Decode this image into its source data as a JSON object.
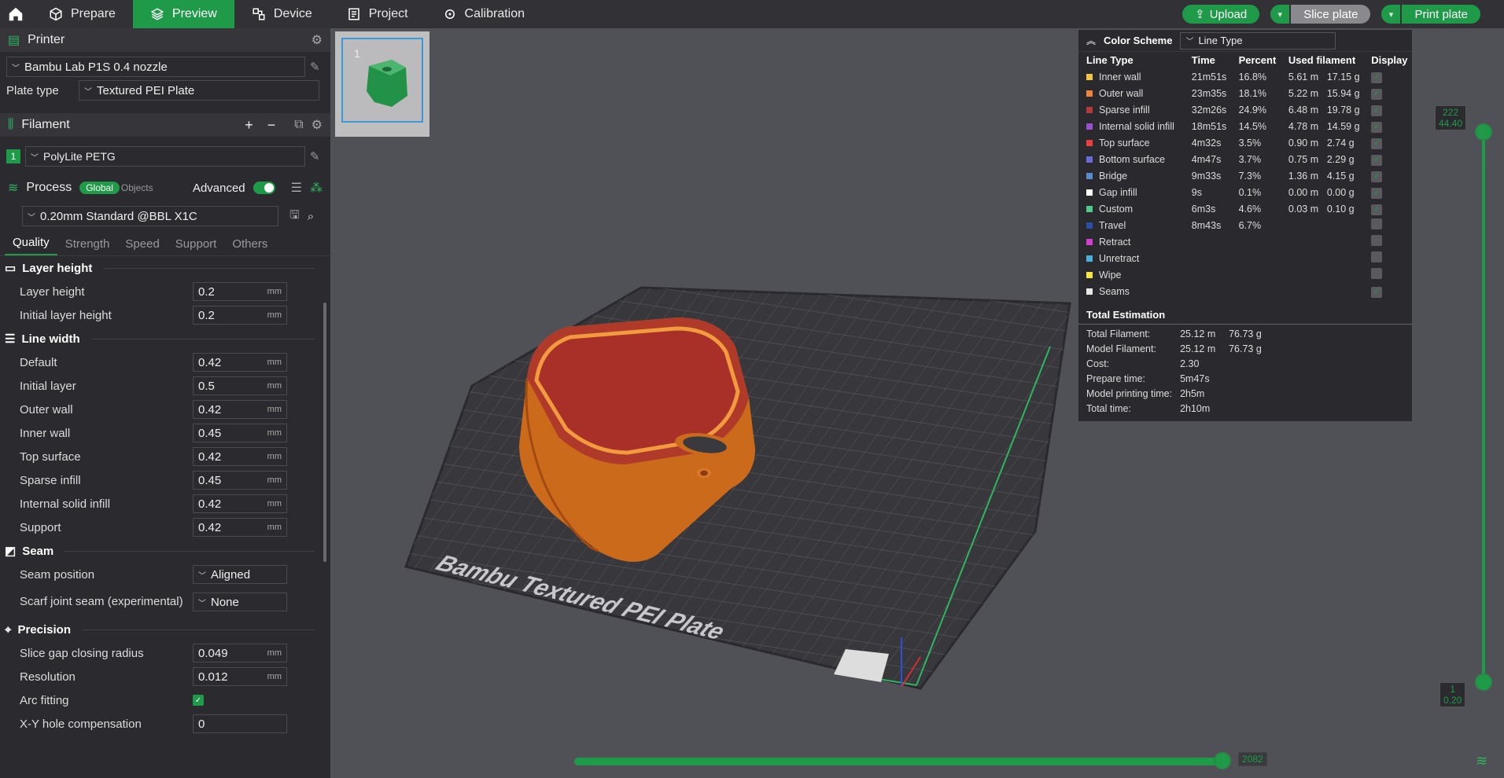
{
  "topbar": {
    "tabs": [
      {
        "label": "Prepare"
      },
      {
        "label": "Preview"
      },
      {
        "label": "Device"
      },
      {
        "label": "Project"
      },
      {
        "label": "Calibration"
      }
    ],
    "upload_label": "Upload",
    "slice_label": "Slice plate",
    "print_label": "Print plate"
  },
  "printer": {
    "section_title": "Printer",
    "selected": "Bambu Lab P1S 0.4 nozzle",
    "plate_type_label": "Plate type",
    "plate_type": "Textured PEI Plate"
  },
  "filament": {
    "section_title": "Filament",
    "slot": "1",
    "name": "PolyLite PETG"
  },
  "process": {
    "section_title": "Process",
    "global_label": "Global",
    "objects_label": "Objects",
    "advanced_label": "Advanced",
    "profile": "0.20mm Standard @BBL X1C",
    "tabs": [
      "Quality",
      "Strength",
      "Speed",
      "Support",
      "Others"
    ],
    "groups": {
      "layer_height": "Layer height",
      "line_width": "Line width",
      "seam": "Seam",
      "precision": "Precision"
    },
    "params": {
      "layer_height": {
        "label": "Layer height",
        "value": "0.2",
        "unit": "mm"
      },
      "initial_layer_height": {
        "label": "Initial layer height",
        "value": "0.2",
        "unit": "mm"
      },
      "lw_default": {
        "label": "Default",
        "value": "0.42",
        "unit": "mm"
      },
      "lw_initial": {
        "label": "Initial layer",
        "value": "0.5",
        "unit": "mm"
      },
      "lw_outer": {
        "label": "Outer wall",
        "value": "0.42",
        "unit": "mm"
      },
      "lw_inner": {
        "label": "Inner wall",
        "value": "0.45",
        "unit": "mm"
      },
      "lw_top": {
        "label": "Top surface",
        "value": "0.42",
        "unit": "mm"
      },
      "lw_sparse": {
        "label": "Sparse infill",
        "value": "0.45",
        "unit": "mm"
      },
      "lw_internal": {
        "label": "Internal solid infill",
        "value": "0.42",
        "unit": "mm"
      },
      "lw_support": {
        "label": "Support",
        "value": "0.42",
        "unit": "mm"
      },
      "seam_position": {
        "label": "Seam position",
        "value": "Aligned"
      },
      "scarf_seam": {
        "label": "Scarf joint seam (experimental)",
        "value": "None"
      },
      "slice_gap": {
        "label": "Slice gap closing radius",
        "value": "0.049",
        "unit": "mm"
      },
      "resolution": {
        "label": "Resolution",
        "value": "0.012",
        "unit": "mm"
      },
      "arc_fitting": {
        "label": "Arc fitting"
      },
      "xy_hole": {
        "label": "X-Y hole compensation",
        "value": "0"
      }
    }
  },
  "plate_thumb": {
    "number": "1"
  },
  "bed_text": "Bambu Textured PEI Plate",
  "legend": {
    "title": "Color Scheme",
    "scheme": "Line Type",
    "headers": [
      "Line Type",
      "Time",
      "Percent",
      "Used filament",
      "Display"
    ],
    "rows": [
      {
        "name": "Inner wall",
        "color": "#f5c542",
        "time": "21m51s",
        "pct": "16.8%",
        "len": "5.61 m",
        "wt": "17.15 g",
        "on": true
      },
      {
        "name": "Outer wall",
        "color": "#f0843c",
        "time": "23m35s",
        "pct": "18.1%",
        "len": "5.22 m",
        "wt": "15.94 g",
        "on": true
      },
      {
        "name": "Sparse infill",
        "color": "#b33a3a",
        "time": "32m26s",
        "pct": "24.9%",
        "len": "6.48 m",
        "wt": "19.78 g",
        "on": true
      },
      {
        "name": "Internal solid infill",
        "color": "#9a4fd0",
        "time": "18m51s",
        "pct": "14.5%",
        "len": "4.78 m",
        "wt": "14.59 g",
        "on": true
      },
      {
        "name": "Top surface",
        "color": "#e84040",
        "time": "4m32s",
        "pct": "3.5%",
        "len": "0.90 m",
        "wt": "2.74 g",
        "on": true
      },
      {
        "name": "Bottom surface",
        "color": "#6a6ad8",
        "time": "4m47s",
        "pct": "3.7%",
        "len": "0.75 m",
        "wt": "2.29 g",
        "on": true
      },
      {
        "name": "Bridge",
        "color": "#5a8ad0",
        "time": "9m33s",
        "pct": "7.3%",
        "len": "1.36 m",
        "wt": "4.15 g",
        "on": true
      },
      {
        "name": "Gap infill",
        "color": "#ffffff",
        "time": "9s",
        "pct": "0.1%",
        "len": "0.00 m",
        "wt": "0.00 g",
        "on": true
      },
      {
        "name": "Custom",
        "color": "#4ecb8a",
        "time": "6m3s",
        "pct": "4.6%",
        "len": "0.03 m",
        "wt": "0.10 g",
        "on": true
      },
      {
        "name": "Travel",
        "color": "#2a4ea8",
        "time": "8m43s",
        "pct": "6.7%",
        "len": "",
        "wt": "",
        "on": false
      },
      {
        "name": "Retract",
        "color": "#d040d0",
        "time": "",
        "pct": "",
        "len": "",
        "wt": "",
        "on": false
      },
      {
        "name": "Unretract",
        "color": "#4ab0e0",
        "time": "",
        "pct": "",
        "len": "",
        "wt": "",
        "on": false
      },
      {
        "name": "Wipe",
        "color": "#f5e842",
        "time": "",
        "pct": "",
        "len": "",
        "wt": "",
        "on": false
      },
      {
        "name": "Seams",
        "color": "#e8e8e8",
        "time": "",
        "pct": "",
        "len": "",
        "wt": "",
        "on": true
      }
    ],
    "total_title": "Total Estimation",
    "totals": [
      {
        "label": "Total Filament:",
        "v1": "25.12 m",
        "v2": "76.73 g"
      },
      {
        "label": "Model Filament:",
        "v1": "25.12 m",
        "v2": "76.73 g"
      },
      {
        "label": "Cost:",
        "v1": "2.30",
        "v2": ""
      },
      {
        "label": "Prepare time:",
        "v1": "5m47s",
        "v2": ""
      },
      {
        "label": "Model printing time:",
        "v1": "2h5m",
        "v2": ""
      },
      {
        "label": "Total time:",
        "v1": "2h10m",
        "v2": ""
      }
    ]
  },
  "layer_slider": {
    "top_layer": "222",
    "top_height": "44.40",
    "bottom_layer": "1",
    "bottom_height": "0.20"
  },
  "move_slider": {
    "value": "2082"
  },
  "colors": {
    "accent": "#1f9a48",
    "panel": "#2b2b2f",
    "viewport": "#505057"
  }
}
